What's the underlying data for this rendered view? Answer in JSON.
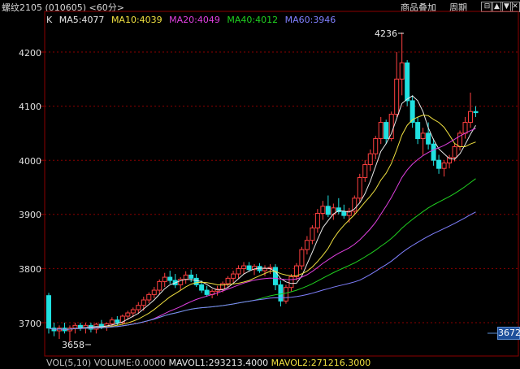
{
  "header": {
    "title": "螺纹2105 (010605) <60分>",
    "buttons": [
      {
        "name": "add-product-button",
        "label": "商品叠加"
      },
      {
        "name": "period-button",
        "label": "周期"
      }
    ],
    "window_controls": [
      "restore-icon",
      "up-arrow-icon",
      "down-arrow-icon",
      "close-icon"
    ]
  },
  "indicators": {
    "k_label": "K",
    "ma": [
      {
        "label": "MA5:4077",
        "color": "#e8e8e8"
      },
      {
        "label": "MA10:4039",
        "color": "#f0e040"
      },
      {
        "label": "MA20:4049",
        "color": "#e040e0"
      },
      {
        "label": "MA40:4012",
        "color": "#20d020"
      },
      {
        "label": "MA60:3946",
        "color": "#8080ff"
      }
    ]
  },
  "annotations": {
    "high_label": "4236",
    "low_label": "3658",
    "current_price_badge": "3672"
  },
  "volume": {
    "label": "VOL(5,10)",
    "volume": "VOLUME:0.0000",
    "mavol1": "MAVOL1:293213.4000",
    "mavol2": "MAVOL2:271216.3000",
    "colors": {
      "label": "#c0c0c0",
      "mavol1": "#e8e8e8",
      "mavol2": "#f0e040"
    }
  },
  "chart_data": {
    "type": "candlestick",
    "y_ticks": [
      3700,
      3800,
      3900,
      4000,
      4100,
      4200
    ],
    "ylim": [
      3640,
      4260
    ],
    "colors": {
      "up": "#ff4040",
      "down": "#20e0e0",
      "grid": "#8b0000"
    },
    "candles": [
      [
        3750,
        3755,
        3680,
        3690
      ],
      [
        3690,
        3700,
        3675,
        3685
      ],
      [
        3685,
        3695,
        3670,
        3690
      ],
      [
        3690,
        3700,
        3680,
        3685
      ],
      [
        3685,
        3695,
        3665,
        3690
      ],
      [
        3690,
        3700,
        3680,
        3695
      ],
      [
        3695,
        3700,
        3685,
        3690
      ],
      [
        3690,
        3700,
        3680,
        3695
      ],
      [
        3695,
        3700,
        3682,
        3688
      ],
      [
        3688,
        3700,
        3680,
        3697
      ],
      [
        3697,
        3705,
        3688,
        3692
      ],
      [
        3692,
        3700,
        3685,
        3698
      ],
      [
        3698,
        3710,
        3692,
        3705
      ],
      [
        3705,
        3712,
        3695,
        3700
      ],
      [
        3700,
        3715,
        3696,
        3712
      ],
      [
        3712,
        3722,
        3705,
        3718
      ],
      [
        3718,
        3728,
        3710,
        3724
      ],
      [
        3724,
        3738,
        3716,
        3732
      ],
      [
        3732,
        3748,
        3722,
        3742
      ],
      [
        3742,
        3756,
        3736,
        3752
      ],
      [
        3752,
        3766,
        3745,
        3760
      ],
      [
        3760,
        3780,
        3752,
        3776
      ],
      [
        3776,
        3792,
        3766,
        3784
      ],
      [
        3784,
        3796,
        3772,
        3778
      ],
      [
        3778,
        3790,
        3764,
        3770
      ],
      [
        3770,
        3784,
        3760,
        3780
      ],
      [
        3780,
        3795,
        3772,
        3788
      ],
      [
        3788,
        3798,
        3775,
        3782
      ],
      [
        3782,
        3790,
        3766,
        3770
      ],
      [
        3770,
        3778,
        3755,
        3760
      ],
      [
        3760,
        3768,
        3748,
        3752
      ],
      [
        3752,
        3762,
        3745,
        3758
      ],
      [
        3758,
        3768,
        3750,
        3762
      ],
      [
        3762,
        3776,
        3756,
        3772
      ],
      [
        3772,
        3786,
        3764,
        3782
      ],
      [
        3782,
        3796,
        3774,
        3790
      ],
      [
        3790,
        3806,
        3782,
        3800
      ],
      [
        3800,
        3812,
        3790,
        3805
      ],
      [
        3805,
        3812,
        3794,
        3798
      ],
      [
        3798,
        3808,
        3788,
        3804
      ],
      [
        3804,
        3810,
        3792,
        3796
      ],
      [
        3796,
        3806,
        3786,
        3800
      ],
      [
        3800,
        3808,
        3790,
        3802
      ],
      [
        3802,
        3808,
        3760,
        3770
      ],
      [
        3770,
        3778,
        3730,
        3740
      ],
      [
        3740,
        3770,
        3735,
        3765
      ],
      [
        3765,
        3790,
        3758,
        3785
      ],
      [
        3785,
        3810,
        3778,
        3805
      ],
      [
        3805,
        3840,
        3798,
        3835
      ],
      [
        3835,
        3860,
        3826,
        3852
      ],
      [
        3852,
        3880,
        3845,
        3875
      ],
      [
        3875,
        3910,
        3866,
        3902
      ],
      [
        3902,
        3925,
        3890,
        3915
      ],
      [
        3915,
        3935,
        3895,
        3900
      ],
      [
        3900,
        3920,
        3890,
        3912
      ],
      [
        3912,
        3930,
        3900,
        3905
      ],
      [
        3905,
        3918,
        3892,
        3898
      ],
      [
        3898,
        3912,
        3885,
        3906
      ],
      [
        3906,
        3935,
        3900,
        3930
      ],
      [
        3930,
        3975,
        3922,
        3968
      ],
      [
        3968,
        4000,
        3960,
        3992
      ],
      [
        3992,
        4020,
        3980,
        4012
      ],
      [
        4012,
        4045,
        4002,
        4040
      ],
      [
        4040,
        4080,
        4030,
        4070
      ],
      [
        4070,
        4075,
        4030,
        4040
      ],
      [
        4040,
        4090,
        4035,
        4085
      ],
      [
        4085,
        4200,
        4080,
        4150
      ],
      [
        4150,
        4236,
        4120,
        4180
      ],
      [
        4180,
        4185,
        4100,
        4110
      ],
      [
        4110,
        4120,
        4060,
        4070
      ],
      [
        4070,
        4080,
        4030,
        4040
      ],
      [
        4040,
        4060,
        4010,
        4050
      ],
      [
        4050,
        4070,
        4020,
        4030
      ],
      [
        4030,
        4040,
        3990,
        4000
      ],
      [
        4000,
        4010,
        3975,
        3985
      ],
      [
        3985,
        4000,
        3970,
        3995
      ],
      [
        3995,
        4010,
        3985,
        4005
      ],
      [
        4005,
        4030,
        3998,
        4025
      ],
      [
        4025,
        4055,
        4018,
        4050
      ],
      [
        4050,
        4080,
        4040,
        4070
      ],
      [
        4070,
        4125,
        4060,
        4090
      ],
      [
        4090,
        4100,
        4080,
        4088
      ]
    ],
    "series": [
      {
        "name": "MA5",
        "color": "#e8e8e8"
      },
      {
        "name": "MA10",
        "color": "#f0e040"
      },
      {
        "name": "MA20",
        "color": "#e040e0"
      },
      {
        "name": "MA40",
        "color": "#20d020"
      },
      {
        "name": "MA60",
        "color": "#8080ff"
      }
    ]
  }
}
